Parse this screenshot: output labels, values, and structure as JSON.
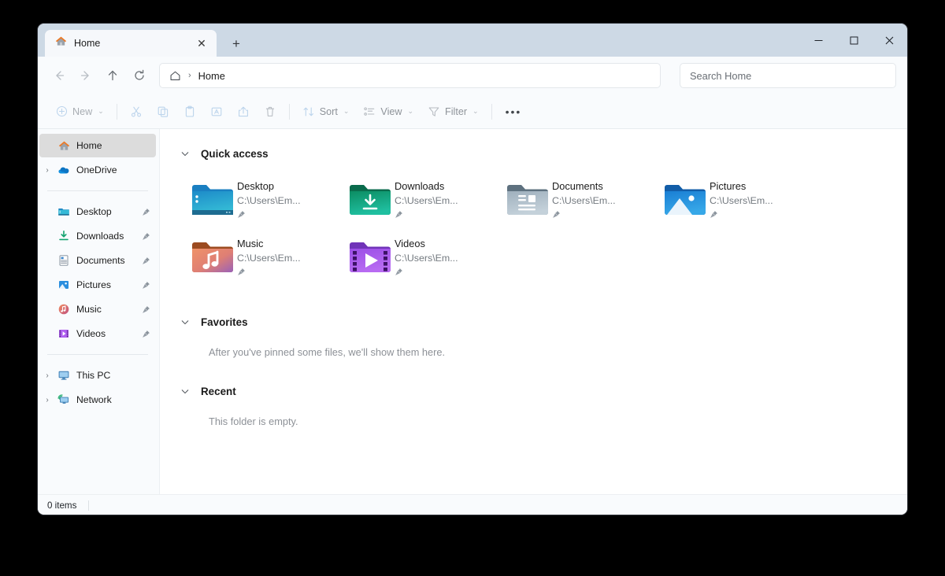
{
  "window": {
    "tab": {
      "title": "Home",
      "icon": "home-icon",
      "close_label": "✕"
    },
    "new_tab_label": "+",
    "controls": {
      "minimize": "−",
      "maximize": "□",
      "close": "✕"
    }
  },
  "address_bar": {
    "back": "←",
    "forward": "→",
    "up": "↑",
    "refresh": "⟳",
    "breadcrumb": {
      "home_icon": "home-outline-icon",
      "separator": "›",
      "current": "Home"
    },
    "search": {
      "placeholder": "Search Home",
      "value": ""
    }
  },
  "toolbar": {
    "new_label": "New",
    "cut_label": "Cut",
    "copy_label": "Copy",
    "paste_label": "Paste",
    "rename_label": "Rename",
    "share_label": "Share",
    "delete_label": "Delete",
    "sort_label": "Sort",
    "view_label": "View",
    "filter_label": "Filter",
    "more_label": "•••",
    "chevron": "⌄"
  },
  "sidebar": {
    "items": [
      {
        "label": "Home",
        "icon": "home-icon",
        "twisty": "",
        "pinned": false,
        "selected": true
      },
      {
        "label": "OneDrive",
        "icon": "onedrive-icon",
        "twisty": "›",
        "pinned": false,
        "selected": false
      }
    ],
    "pinned_items": [
      {
        "label": "Desktop",
        "icon": "desktop-folder-icon",
        "pinned": true
      },
      {
        "label": "Downloads",
        "icon": "downloads-folder-icon",
        "pinned": true
      },
      {
        "label": "Documents",
        "icon": "documents-folder-icon",
        "pinned": true
      },
      {
        "label": "Pictures",
        "icon": "pictures-folder-icon",
        "pinned": true
      },
      {
        "label": "Music",
        "icon": "music-folder-icon",
        "pinned": true
      },
      {
        "label": "Videos",
        "icon": "videos-folder-icon",
        "pinned": true
      }
    ],
    "device_items": [
      {
        "label": "This PC",
        "icon": "this-pc-icon",
        "twisty": "›"
      },
      {
        "label": "Network",
        "icon": "network-icon",
        "twisty": "›"
      }
    ],
    "pin_glyph": "📌"
  },
  "content": {
    "quick_access": {
      "title": "Quick access",
      "chevron": "⌄",
      "tiles": [
        {
          "name": "Desktop",
          "path": "C:\\Users\\Em...",
          "icon": "desktop-folder-icon",
          "pinned": true
        },
        {
          "name": "Downloads",
          "path": "C:\\Users\\Em...",
          "icon": "downloads-folder-icon",
          "pinned": true
        },
        {
          "name": "Documents",
          "path": "C:\\Users\\Em...",
          "icon": "documents-folder-icon",
          "pinned": true
        },
        {
          "name": "Pictures",
          "path": "C:\\Users\\Em...",
          "icon": "pictures-folder-icon",
          "pinned": true
        },
        {
          "name": "Music",
          "path": "C:\\Users\\Em...",
          "icon": "music-folder-icon",
          "pinned": true
        },
        {
          "name": "Videos",
          "path": "C:\\Users\\Em...",
          "icon": "videos-folder-icon",
          "pinned": true
        }
      ]
    },
    "favorites": {
      "title": "Favorites",
      "chevron": "⌄",
      "empty_text": "After you've pinned some files, we'll show them here."
    },
    "recent": {
      "title": "Recent",
      "chevron": "⌄",
      "empty_text": "This folder is empty."
    }
  },
  "status_bar": {
    "items_count": "0 items"
  },
  "colors": {
    "titlebar": "#cdd9e5",
    "chrome": "#f9fbfd",
    "content": "#ffffff",
    "selection": "#dcdcdc",
    "accent_orange": "#ec7a27",
    "onedrive_blue": "#0c75c4",
    "desktop_teal": "#2bb3c8",
    "downloads_green": "#13a67e",
    "documents_gray": "#8c9aa8",
    "pictures_blue": "#2a8ede",
    "music_coral": "#e8886a",
    "videos_purple": "#9a4fe0"
  }
}
